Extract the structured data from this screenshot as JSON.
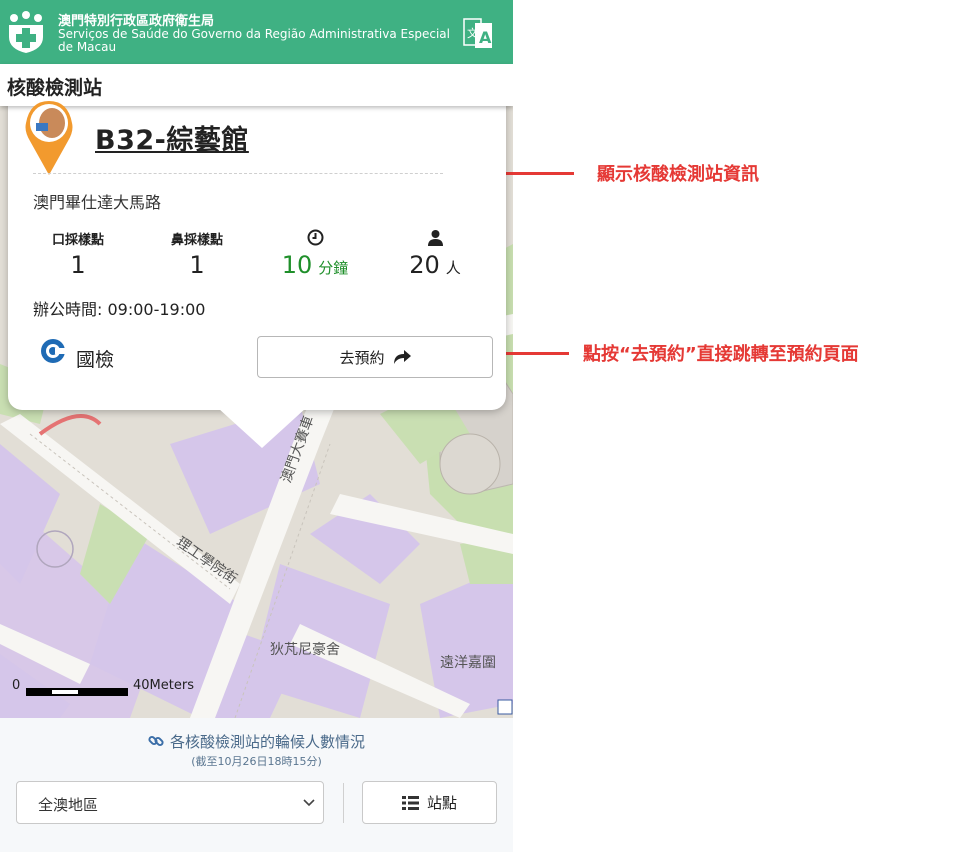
{
  "header": {
    "org_zh": "澳門特別行政區政府衛生局",
    "org_pt": "Serviços de Saúde do Governo da Região Administrativa Especial de Macau",
    "page_title": "核酸檢測站",
    "brand_color": "#3fb183"
  },
  "map": {
    "labels": [
      "理工學院街",
      "澳門大賽車",
      "狄芃尼豪舍",
      "遠洋嘉圍"
    ],
    "scale_start": "0",
    "scale_end": "40Meters"
  },
  "popup": {
    "station_name": "B32-綜藝館",
    "address": "澳門畢仕達大馬路",
    "stats": [
      {
        "label": "口採樣點",
        "value": "1",
        "unit": ""
      },
      {
        "label": "鼻採樣點",
        "value": "1",
        "unit": ""
      },
      {
        "icon": "clock-icon",
        "value": "10",
        "unit": "分鐘"
      },
      {
        "icon": "person-icon",
        "value": "20",
        "unit": "人"
      }
    ],
    "hours": "辦公時間: 09:00-19:00",
    "operator": "國檢",
    "book_label": "去預約"
  },
  "bottom": {
    "queue_link": "各核酸檢測站的輪候人數情況",
    "queue_sub": "(截至10月26日18時15分)",
    "region_selected": "全澳地區",
    "stations_label": "站點"
  },
  "annotations": {
    "info_note": "顯示核酸檢測站資訊",
    "book_note": "點按“去預約”直接跳轉至預約頁面",
    "color": "#e53935"
  }
}
